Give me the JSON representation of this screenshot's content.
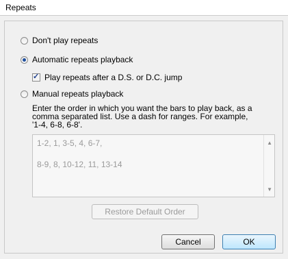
{
  "window": {
    "title": "Repeats"
  },
  "options": {
    "dont_play": "Don't play repeats",
    "automatic": "Automatic repeats playback",
    "after_jump": "Play repeats after a D.S. or D.C. jump",
    "manual": "Manual repeats playback"
  },
  "manual_description": "Enter the order in which you want the bars to play back, as a comma separated list. Use a dash for ranges. For example, '1-4, 6-8, 6-8'.",
  "order_text": {
    "line1": "1-2, 1, 3-5, 4, 6-7,",
    "line2": "8-9, 8, 10-12, 11, 13-14"
  },
  "buttons": {
    "restore": "Restore Default Order",
    "cancel": "Cancel",
    "ok": "OK"
  },
  "selected_option": "automatic",
  "after_jump_checked": true
}
